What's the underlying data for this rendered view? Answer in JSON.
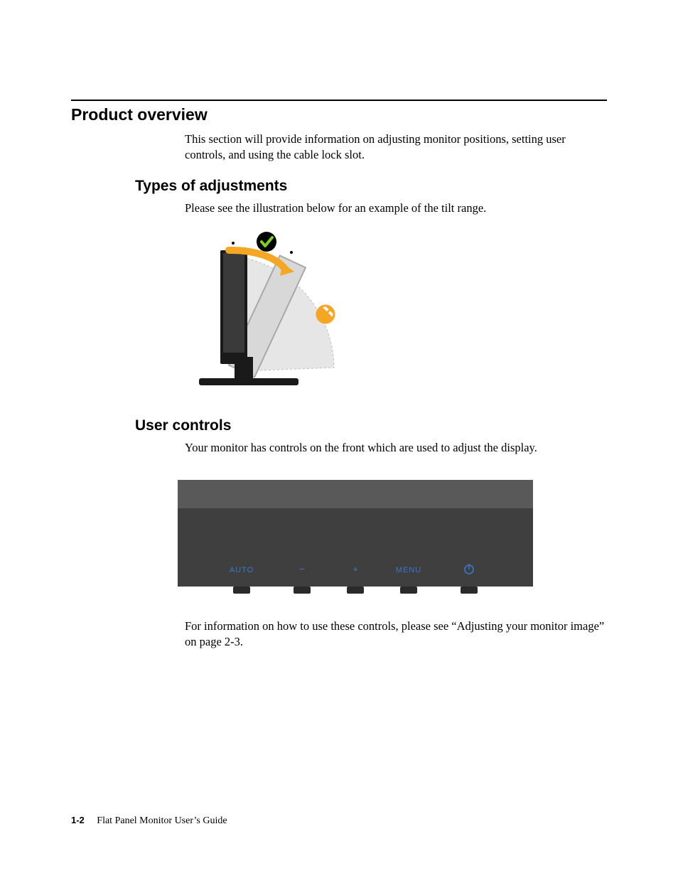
{
  "headings": {
    "product_overview": "Product overview",
    "types_of_adjustments": "Types of adjustments",
    "user_controls": "User controls"
  },
  "paragraphs": {
    "overview_intro": "This section will provide information on adjusting monitor positions, setting user controls, and using the cable lock slot.",
    "tilt_intro": "Please see the illustration below for an example of the tilt range.",
    "controls_intro": "Your monitor has controls on the front which are used to adjust the display.",
    "controls_ref": "For information on how to use these controls, please see “Adjusting your monitor image” on page 2-3."
  },
  "figures": {
    "controls_labels": {
      "auto": "AUTO",
      "minus": "−",
      "plus": "+",
      "menu": "MENU",
      "power": "⏻"
    }
  },
  "footer": {
    "page_number": "1-2",
    "book_title": "Flat Panel Monitor User’s Guide"
  }
}
